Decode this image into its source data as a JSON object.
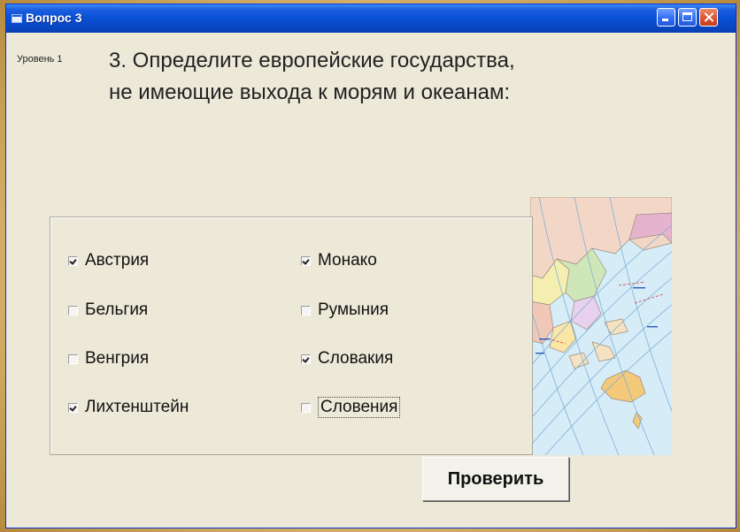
{
  "window": {
    "title": "Вопрос 3"
  },
  "level_label": "Уровень 1",
  "question": {
    "line1": "3. Определите европейские государства,",
    "line2": "не имеющие выхода к морям и океанам:"
  },
  "options": [
    {
      "label": "Австрия",
      "checked": true
    },
    {
      "label": "Бельгия",
      "checked": false
    },
    {
      "label": "Венгрия",
      "checked": false
    },
    {
      "label": "Лихтенштейн",
      "checked": true
    },
    {
      "label": "Монако",
      "checked": true
    },
    {
      "label": "Румыния",
      "checked": false
    },
    {
      "label": "Словакия",
      "checked": true
    },
    {
      "label": "Словения",
      "checked": false
    }
  ],
  "submit_label": "Проверить",
  "colors": {
    "titlebar": "#0a52d6",
    "window_bg": "#ece9d8",
    "map_water": "#d6ecf7"
  },
  "icons": [
    "app-icon",
    "minimize-icon",
    "maximize-icon",
    "close-icon",
    "map-image"
  ]
}
